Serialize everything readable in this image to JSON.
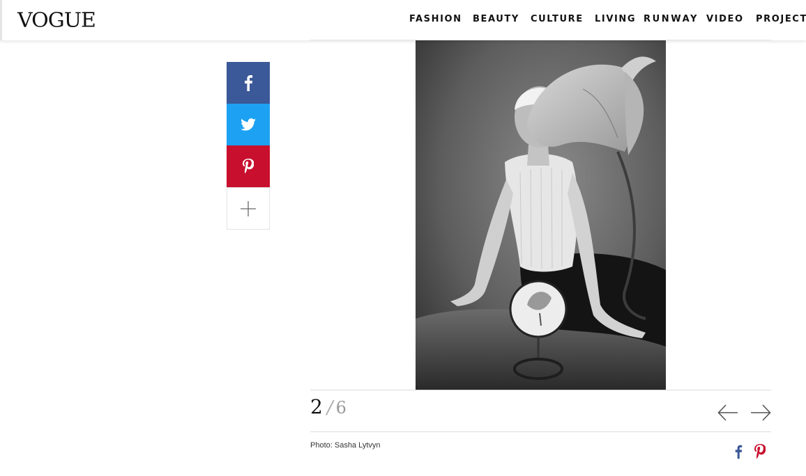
{
  "header": {
    "logo": "VOGUE",
    "nav": [
      {
        "label": "FASHION"
      },
      {
        "label": "BEAUTY"
      },
      {
        "label": "CULTURE"
      },
      {
        "label": "LIVING"
      },
      {
        "label": "RUNWAY"
      },
      {
        "label": "VIDEO"
      },
      {
        "label": "PROJECTS"
      }
    ]
  },
  "share": {
    "buttons": [
      {
        "name": "facebook",
        "icon": "facebook-icon",
        "color": "#3b5998"
      },
      {
        "name": "twitter",
        "icon": "twitter-icon",
        "color": "#1da1f2"
      },
      {
        "name": "pinterest",
        "icon": "pinterest-icon",
        "color": "#c8102e"
      },
      {
        "name": "more",
        "icon": "plus-icon",
        "color": "#ffffff"
      }
    ]
  },
  "gallery": {
    "current": "2",
    "separator": "/",
    "total": "6",
    "prev_icon": "arrow-left-icon",
    "next_icon": "arrow-right-icon",
    "credit": "Photo: Sasha Lytvyn",
    "photo_icon": "photo-woman-lily-mirror"
  }
}
